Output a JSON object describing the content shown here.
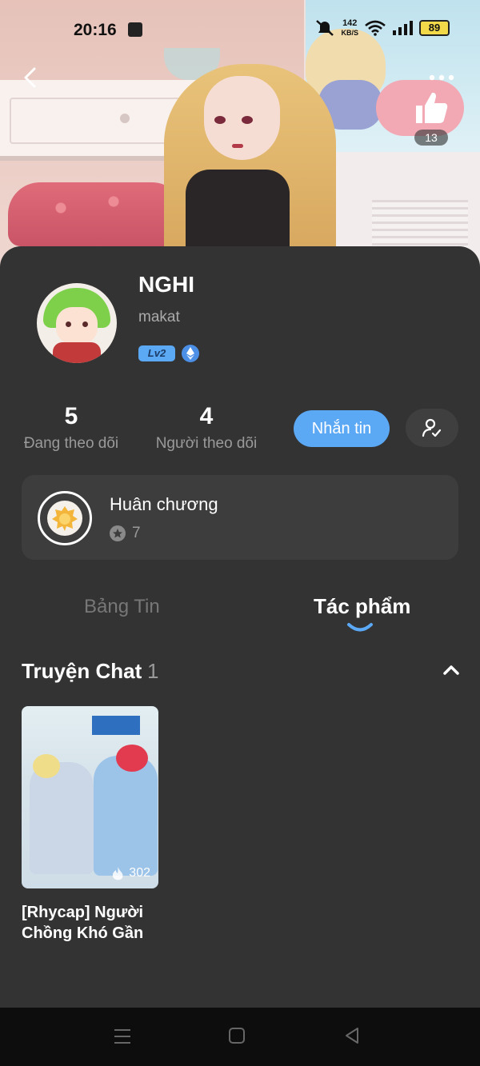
{
  "status_bar": {
    "time": "20:16",
    "network_speed_value": "142",
    "network_speed_unit": "KB/S",
    "battery": "89",
    "icons": [
      "shopping-bag-icon",
      "mute-icon",
      "wifi-icon",
      "signal-icon",
      "battery-icon"
    ]
  },
  "header": {
    "like_count": "13",
    "icons": [
      "back-icon",
      "more-icon",
      "thumbs-up-icon"
    ]
  },
  "profile": {
    "name": "NGHI",
    "handle": "makat",
    "level": "Lv2",
    "badge_icon": "ethereum-badge-icon"
  },
  "stats": {
    "following_count": "5",
    "following_label": "Đang theo dõi",
    "followers_count": "4",
    "followers_label": "Người theo dõi"
  },
  "actions": {
    "message_label": "Nhắn tin",
    "follow_icon": "user-check-icon"
  },
  "medal": {
    "title": "Huân chương",
    "count": "7"
  },
  "tabs": {
    "feed_label": "Bảng Tin",
    "works_label": "Tác phẩm",
    "active": "works"
  },
  "section": {
    "title": "Truyện Chat",
    "count": "1"
  },
  "stories": [
    {
      "title": "[Rhycap] Người Chồng Khó Gần",
      "views": "302"
    }
  ],
  "colors": {
    "accent": "#5ba8f5",
    "panel_bg": "#333333",
    "card_bg": "#3d3d3d",
    "navbar_bg": "#0d0d0d"
  }
}
